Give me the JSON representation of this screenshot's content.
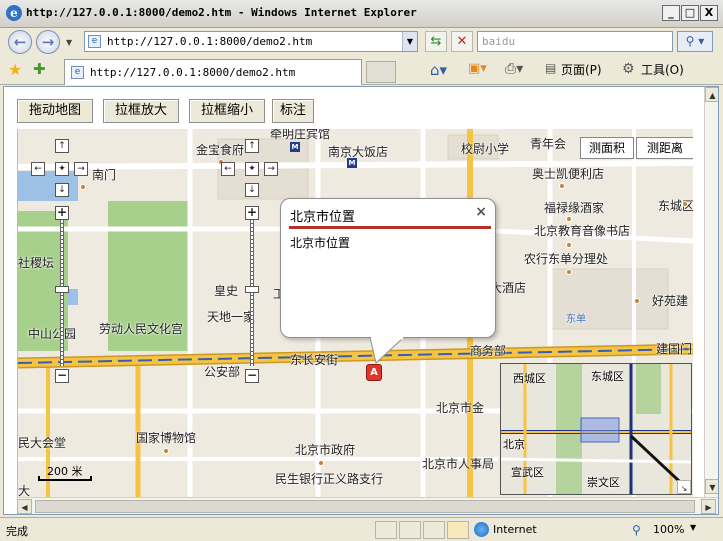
{
  "window": {
    "title": "http://127.0.0.1:8000/demo2.htm - Windows Internet Explorer",
    "minimize": "_",
    "maximize": "□",
    "close": "X"
  },
  "address_bar": {
    "url": "http://127.0.0.1:8000/demo2.htm",
    "search_placeholder": "baidu"
  },
  "tab": {
    "label": "http://127.0.0.1:8000/demo2.htm"
  },
  "command_bar": {
    "page": "页面(P)",
    "tools": "工具(O)"
  },
  "toolbar": {
    "buttons": [
      "拖动地图",
      "拉框放大",
      "拉框缩小",
      "标注"
    ]
  },
  "map": {
    "buttons": [
      "测面积",
      "测距离"
    ],
    "labels": [
      "牵明庄宾馆",
      "金宝食府",
      "南京大饭店",
      "校尉小学",
      "青年会",
      "奥士凯便利店",
      "南门",
      "福禄缘酒家",
      "东城区",
      "北京教育音像书店",
      "农行东单分理处",
      "大酒店",
      "好苑建",
      "东单",
      "皇史",
      "天地一家",
      "劳动人民文化宫",
      "中山公园",
      "社稷坛",
      "东长安街",
      "商务部",
      "建国门",
      "公安部",
      "北京市金",
      "国家博物馆",
      "北京市政府",
      "北京市人事局",
      "民生银行正义路支行",
      "民大会堂",
      "大",
      "工"
    ],
    "scale": "200 米",
    "marker_letter": "A"
  },
  "info_window": {
    "title": "北京市位置",
    "body": "北京市位置",
    "close": "×"
  },
  "overview": {
    "labels": [
      "西城区",
      "东城区",
      "北京",
      "宣武区",
      "崇文区"
    ]
  },
  "status_bar": {
    "status": "完成",
    "zone": "Internet",
    "zoom": "100%"
  },
  "colors": {
    "road_major": "#f6c343",
    "road_outline": "#c99a22",
    "park": "#a8d08d",
    "water": "#9cc0e6",
    "info_rule": "#b3312b",
    "marker": "#e03527"
  }
}
